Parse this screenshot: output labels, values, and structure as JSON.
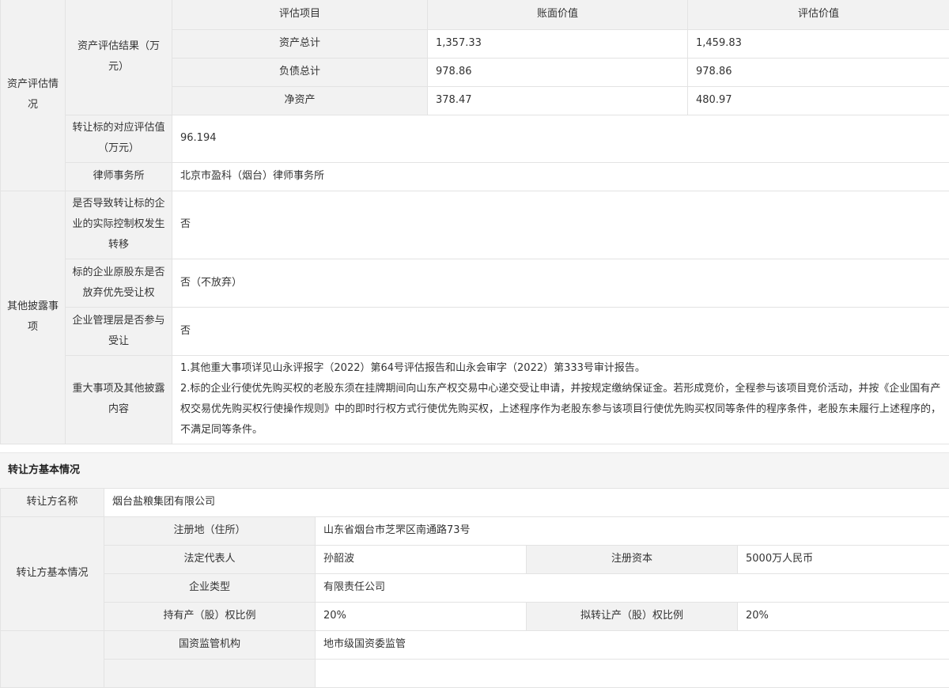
{
  "asset_eval": {
    "section_label": "资产评估情况",
    "result_label": "资产评估结果（万元）",
    "headers": [
      "评估项目",
      "账面价值",
      "评估价值"
    ],
    "rows": [
      {
        "item": "资产总计",
        "book": "1,357.33",
        "eval": "1,459.83"
      },
      {
        "item": "负债总计",
        "book": "978.86",
        "eval": "978.86"
      },
      {
        "item": "净资产",
        "book": "378.47",
        "eval": "480.97"
      }
    ],
    "target_value_label": "转让标的对应评估值（万元）",
    "target_value": "96.194",
    "law_firm_label": "律师事务所",
    "law_firm": "北京市盈科（烟台）律师事务所"
  },
  "other_disclosure": {
    "section_label": "其他披露事项",
    "control_transfer_label": "是否导致转让标的企业的实际控制权发生转移",
    "control_transfer": "否",
    "preemptive_label": "标的企业原股东是否放弃优先受让权",
    "preemptive": "否（不放弃）",
    "mgmt_label": "企业管理层是否参与受让",
    "mgmt": "否",
    "major_label": "重大事项及其他披露内容",
    "major_lines": [
      "1.其他重大事项详见山永评报字（2022）第64号评估报告和山永会审字（2022）第333号审计报告。",
      "2.标的企业行使优先购买权的老股东须在挂牌期间向山东产权交易中心递交受让申请，并按规定缴纳保证金。若形成竞价，全程参与该项目竞价活动，并按《企业国有产权交易优先购买权行使操作规则》中的即时行权方式行使优先购买权，上述程序作为老股东参与该项目行使优先购买权同等条件的程序条件，老股东未履行上述程序的，不满足同等条件。"
    ]
  },
  "transferor": {
    "section_title": "转让方基本情况",
    "name_label": "转让方名称",
    "name": "烟台盐粮集团有限公司",
    "basic_label": "转让方基本情况",
    "address_label": "注册地（住所）",
    "address": "山东省烟台市芝罘区南通路73号",
    "legal_rep_label": "法定代表人",
    "legal_rep": "孙韶波",
    "capital_label": "注册资本",
    "capital": "5000万人民币",
    "type_label": "企业类型",
    "type": "有限责任公司",
    "hold_ratio_label": "持有产（股）权比例",
    "hold_ratio": "20%",
    "transfer_ratio_label": "拟转让产（股）权比例",
    "transfer_ratio": "20%",
    "supervisor_label": "国资监管机构",
    "supervisor": "地市级国资委监管"
  }
}
